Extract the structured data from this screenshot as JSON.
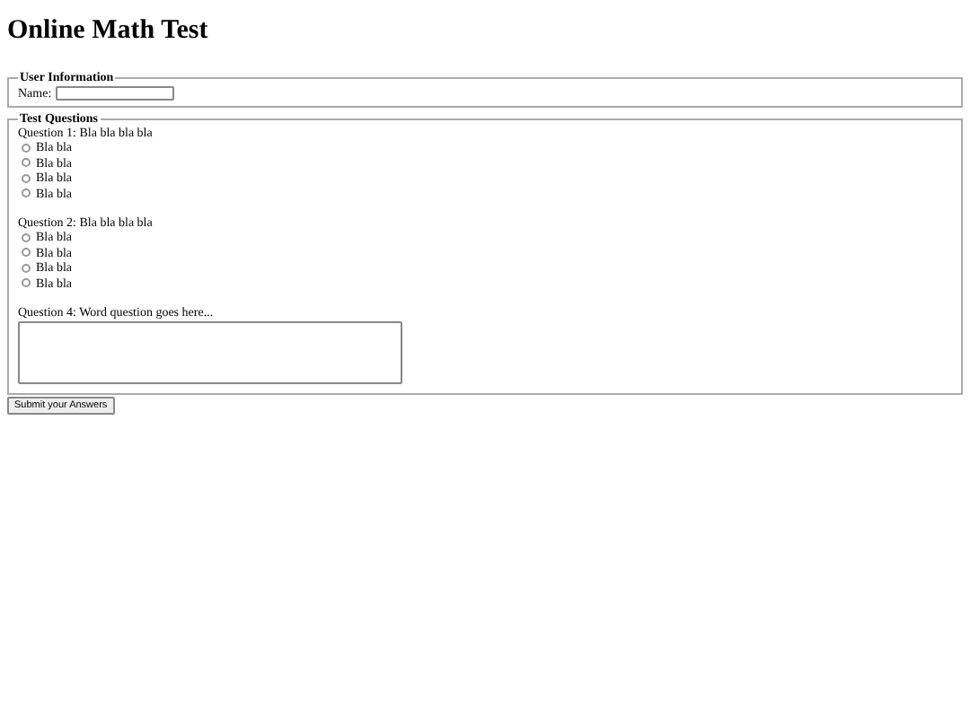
{
  "title": "Online Math Test",
  "user_info": {
    "legend": "User Information",
    "name_label": "Name:"
  },
  "test": {
    "legend": "Test Questions",
    "questions": [
      {
        "kind": "choice",
        "text": "Question 1: Bla bla bla bla",
        "options": [
          {
            "label": "Bla bla",
            "selected": false
          },
          {
            "label": "Bla bla",
            "selected": false
          },
          {
            "label": "Bla bla",
            "selected": false
          },
          {
            "label": "Bla bla",
            "selected": false
          }
        ]
      },
      {
        "kind": "choice",
        "text": "Question 2: Bla bla bla bla",
        "options": [
          {
            "label": "Bla bla",
            "selected": false
          },
          {
            "label": "Bla bla",
            "selected": false
          },
          {
            "label": "Bla bla",
            "selected": false
          },
          {
            "label": "Bla bla",
            "selected": false
          }
        ]
      },
      {
        "kind": "text",
        "text": "Question 4: Word question goes here..."
      }
    ]
  },
  "submit": "Submit your Answers"
}
